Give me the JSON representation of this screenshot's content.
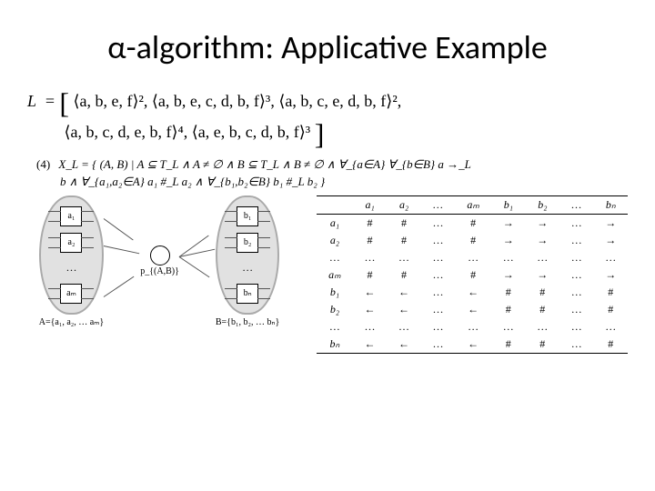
{
  "title": "α-algorithm: Applicative Example",
  "L_eq": {
    "lhs": "L",
    "eq": "=",
    "line1_open": "[",
    "terms1": "⟨a, b, e, f⟩²,  ⟨a, b, e, c, d, b, f⟩³,  ⟨a, b, c, e, d, b, f⟩²,",
    "terms2": "⟨a, b, c, d, e, b, f⟩⁴,  ⟨a, e, b, c, d, b, f⟩³",
    "close": "]"
  },
  "item4": {
    "no": "(4)",
    "line1": "X_L = { (A, B) | A ⊆ T_L  ∧  A ≠ ∅  ∧  B ⊆ T_L  ∧  B ≠ ∅  ∧  ∀_{a∈A} ∀_{b∈B}  a →_L",
    "line2": "b  ∧  ∀_{a₁,a₂∈A}  a₁ #_L a₂  ∧  ∀_{b₁,b₂∈B}  b₁ #_L b₂ }"
  },
  "diagram": {
    "leftBoxes": [
      "a₁",
      "a₂",
      "…",
      "aₘ"
    ],
    "rightBoxes": [
      "b₁",
      "b₂",
      "…",
      "bₙ"
    ],
    "placeLabel": "p_{(A,B)}",
    "Alabel": "A={a₁, a₂, … aₘ}",
    "Blabel": "B={b₁, b₂, … bₙ}"
  },
  "table": {
    "head": [
      "",
      "a₁",
      "a₂",
      "…",
      "aₘ",
      "b₁",
      "b₂",
      "…",
      "bₙ"
    ],
    "rows": [
      [
        "a₁",
        "#",
        "#",
        "…",
        "#",
        "→",
        "→",
        "…",
        "→"
      ],
      [
        "a₂",
        "#",
        "#",
        "…",
        "#",
        "→",
        "→",
        "…",
        "→"
      ],
      [
        "…",
        "…",
        "…",
        "…",
        "…",
        "…",
        "…",
        "…",
        "…"
      ],
      [
        "aₘ",
        "#",
        "#",
        "…",
        "#",
        "→",
        "→",
        "…",
        "→"
      ],
      [
        "b₁",
        "←",
        "←",
        "…",
        "←",
        "#",
        "#",
        "…",
        "#"
      ],
      [
        "b₂",
        "←",
        "←",
        "…",
        "←",
        "#",
        "#",
        "…",
        "#"
      ],
      [
        "…",
        "…",
        "…",
        "…",
        "…",
        "…",
        "…",
        "…",
        "…"
      ],
      [
        "bₙ",
        "←",
        "←",
        "…",
        "←",
        "#",
        "#",
        "…",
        "#"
      ]
    ]
  }
}
